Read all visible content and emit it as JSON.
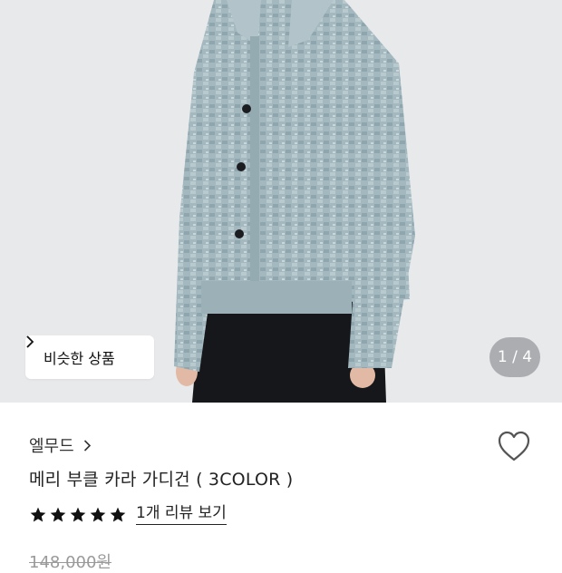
{
  "gallery": {
    "similar_button_label": "비슷한 상품",
    "image_counter": "1 / 4"
  },
  "product": {
    "brand": "엘무드",
    "name": "메리 부클 카라 가디건 ( 3COLOR )",
    "rating_stars": 5,
    "review_link": "1개 리뷰 보기",
    "original_price": "148,000원"
  },
  "colors": {
    "gallery_background": "#e8e9eb",
    "cardigan": "#9fb6bd",
    "text_primary": "#222222",
    "price_muted": "#9a9a9a"
  },
  "icons": {
    "similar_chevron": "chevron-right-icon",
    "brand_chevron": "chevron-right-icon",
    "wishlist": "heart-outline-icon",
    "star": "star-filled-icon"
  }
}
